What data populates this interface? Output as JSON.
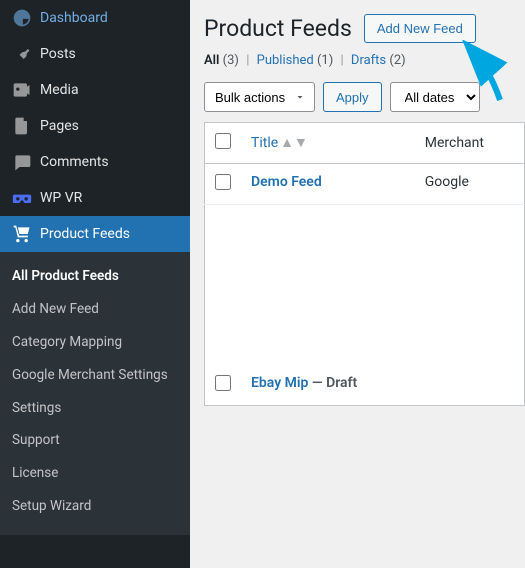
{
  "sidebar": {
    "items": [
      {
        "label": "Dashboard"
      },
      {
        "label": "Posts"
      },
      {
        "label": "Media"
      },
      {
        "label": "Pages"
      },
      {
        "label": "Comments"
      },
      {
        "label": "WP VR"
      },
      {
        "label": "Product Feeds"
      }
    ],
    "submenu": [
      {
        "label": "All Product Feeds"
      },
      {
        "label": "Add New Feed"
      },
      {
        "label": "Category Mapping"
      },
      {
        "label": "Google Merchant Settings"
      },
      {
        "label": "Settings"
      },
      {
        "label": "Support"
      },
      {
        "label": "License"
      },
      {
        "label": "Setup Wizard"
      }
    ]
  },
  "header": {
    "title": "Product Feeds",
    "add_new": "Add New Feed"
  },
  "status": {
    "all_label": "All",
    "all_count": "(3)",
    "pub_label": "Published",
    "pub_count": "(1)",
    "drafts_label": "Drafts",
    "drafts_count": "(2)"
  },
  "controls": {
    "bulk_selected": "Bulk actions",
    "apply": "Apply",
    "dates_selected": "All dates"
  },
  "table": {
    "col_title": "Title",
    "col_merchant": "Merchant",
    "rows": [
      {
        "title": "Demo Feed",
        "state": "",
        "merchant": "Google"
      },
      {
        "title": "Ebay Mip",
        "state": "— Draft",
        "merchant": ""
      }
    ]
  }
}
